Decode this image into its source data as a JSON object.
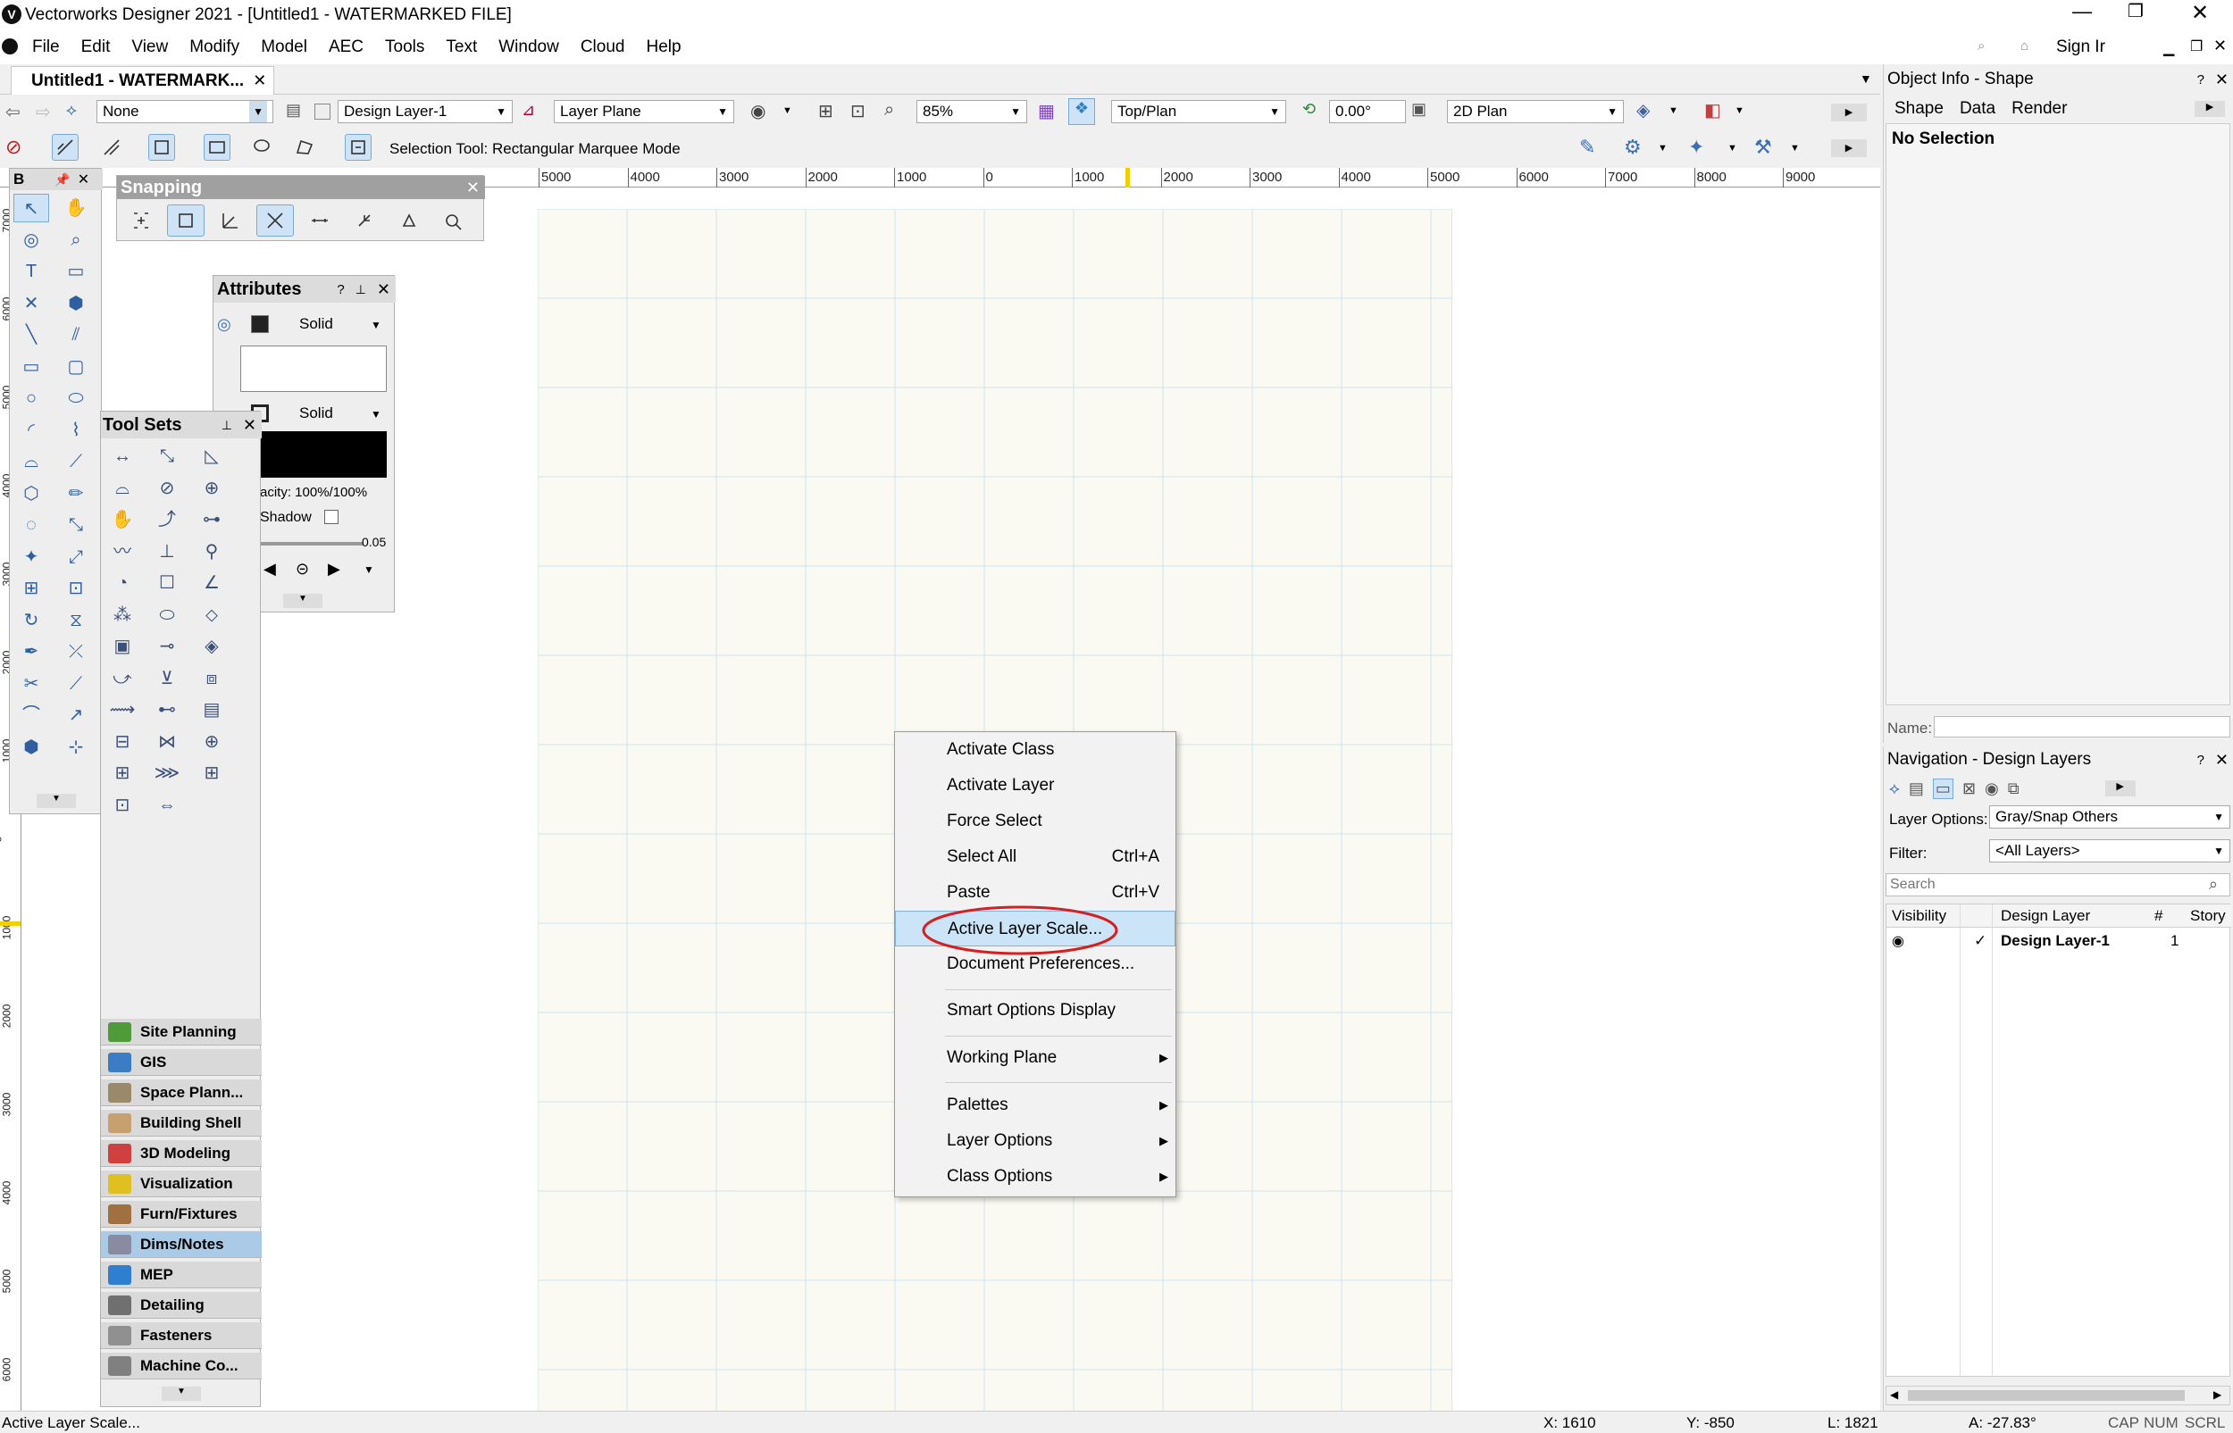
{
  "app": {
    "title": "Vectorworks Designer 2021 - [Untitled1 - WATERMARKED FILE]"
  },
  "menu": [
    "File",
    "Edit",
    "View",
    "Modify",
    "Model",
    "AEC",
    "Tools",
    "Text",
    "Window",
    "Cloud",
    "Help"
  ],
  "account": {
    "sign_in": "Sign Ir"
  },
  "doc_tab": {
    "label": "Untitled1 - WATERMARK..."
  },
  "view_bar": {
    "class_value": "None",
    "layer_value": "Design Layer-1",
    "plane_value": "Layer Plane",
    "zoom_value": "85%",
    "view_value": "Top/Plan",
    "rotation_value": "0.00°",
    "render_value": "2D Plan"
  },
  "tool_bar": {
    "mode_text": "Selection Tool: Rectangular Marquee Mode"
  },
  "ruler": {
    "top_labels": [
      "5000",
      "4000",
      "3000",
      "2000",
      "1000",
      "0",
      "1000",
      "2000",
      "3000",
      "4000",
      "5000",
      "6000",
      "7000",
      "8000",
      "9000"
    ],
    "left_labels": [
      "7000",
      "6000",
      "5000",
      "4000",
      "3000",
      "2000",
      "1000",
      "0",
      "1000",
      "2000",
      "3000",
      "4000",
      "5000",
      "6000"
    ]
  },
  "palettes": {
    "basic": {
      "title": "B"
    },
    "snapping": {
      "title": "Snapping"
    },
    "attributes": {
      "title": "Attributes",
      "fill_style": "Solid",
      "pen_style": "Solid",
      "opacity": "acity: 100%/100%",
      "shadow": "Shadow",
      "line_weight": "0.05"
    },
    "tool_sets": {
      "title": "Tool Sets",
      "categories": [
        "Site Planning",
        "GIS",
        "Space Plann...",
        "Building Shell",
        "3D Modeling",
        "Visualization",
        "Furn/Fixtures",
        "Dims/Notes",
        "MEP",
        "Detailing",
        "Fasteners",
        "Machine Co..."
      ],
      "selected": "Dims/Notes",
      "category_colors": [
        "#4f9b3a",
        "#3b7cc4",
        "#9a8a6a",
        "#c8a070",
        "#d04040",
        "#e0c020",
        "#a07040",
        "#8a8aa0",
        "#2f7fd0",
        "#707070",
        "#909090",
        "#808080"
      ]
    }
  },
  "context_menu": {
    "items": [
      {
        "label": "Activate Class",
        "shortcut": "",
        "submenu": false
      },
      {
        "label": "Activate Layer",
        "shortcut": "",
        "submenu": false
      },
      {
        "label": "Force Select",
        "shortcut": "",
        "submenu": false
      },
      {
        "label": "Select All",
        "shortcut": "Ctrl+A",
        "submenu": false
      },
      {
        "label": "Paste",
        "shortcut": "Ctrl+V",
        "submenu": false
      },
      {
        "label": "Active Layer Scale...",
        "shortcut": "",
        "submenu": false
      },
      {
        "label": "Document Preferences...",
        "shortcut": "",
        "submenu": false
      },
      {
        "label": "Smart Options Display",
        "shortcut": "",
        "submenu": false
      },
      {
        "label": "Working Plane",
        "shortcut": "",
        "submenu": true
      },
      {
        "label": "Palettes",
        "shortcut": "",
        "submenu": true
      },
      {
        "label": "Layer Options",
        "shortcut": "",
        "submenu": true
      },
      {
        "label": "Class Options",
        "shortcut": "",
        "submenu": true
      }
    ],
    "highlighted": "Active Layer Scale..."
  },
  "object_info": {
    "title": "Object Info - Shape",
    "tabs": [
      "Shape",
      "Data",
      "Render"
    ],
    "selection": "No Selection",
    "name_label": "Name:"
  },
  "navigation": {
    "title": "Navigation - Design Layers",
    "layer_options_label": "Layer Options:",
    "layer_options_value": "Gray/Snap Others",
    "filter_label": "Filter:",
    "filter_value": "<All Layers>",
    "search_placeholder": "Search",
    "columns": [
      "Visibility",
      "Design Layer",
      "#",
      "Story"
    ],
    "rows": [
      {
        "active": "✓",
        "name": "Design Layer-1",
        "num": "1"
      }
    ]
  },
  "status": {
    "message": "Active Layer Scale...",
    "x": "X: 1610",
    "y": "Y: -850",
    "l": "L: 1821",
    "a": "A: -27.83°",
    "cap": "CAP",
    "num": "NUM",
    "scrl": "SCRL"
  },
  "colors": {
    "accent": "#cfe3f7",
    "drawing_bg": "#fafaf2",
    "grid": "#cde4f0",
    "annotation": "#d42020"
  }
}
